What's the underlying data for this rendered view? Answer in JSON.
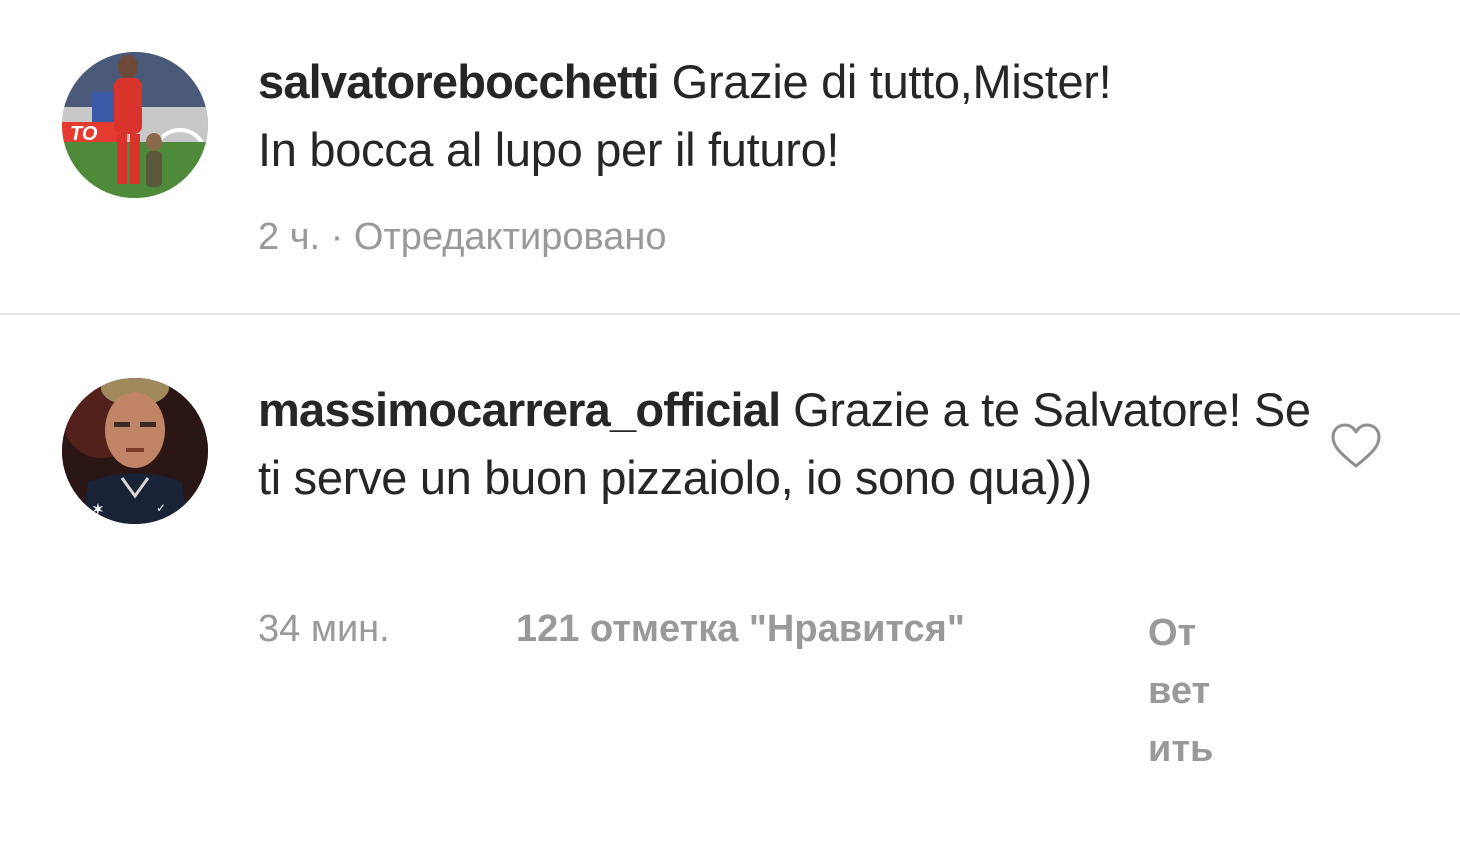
{
  "comments": [
    {
      "username": "salvatorebocchetti",
      "text_line1": " Grazie di tutto,Mister!",
      "text_line2": "In bocca al lupo per il futuro!",
      "time": "2 ч.",
      "separator": " · ",
      "edited": "Отредактировано",
      "avatar_icon": "avatar-photo-footballer"
    },
    {
      "username": "massimocarrera_official",
      "text": " Grazie a te Salvatore! Se ti serve un buon pizzaiolo, io sono qua)))",
      "time": "34 мин.",
      "likes": "121 отметка \"Нравится\"",
      "reply": "Ответить",
      "like_icon": "heart-outline-icon",
      "avatar_icon": "avatar-photo-man"
    }
  ],
  "colors": {
    "text_primary": "#262626",
    "text_secondary": "#999999",
    "divider": "#e6e6e6",
    "background": "#ffffff"
  }
}
